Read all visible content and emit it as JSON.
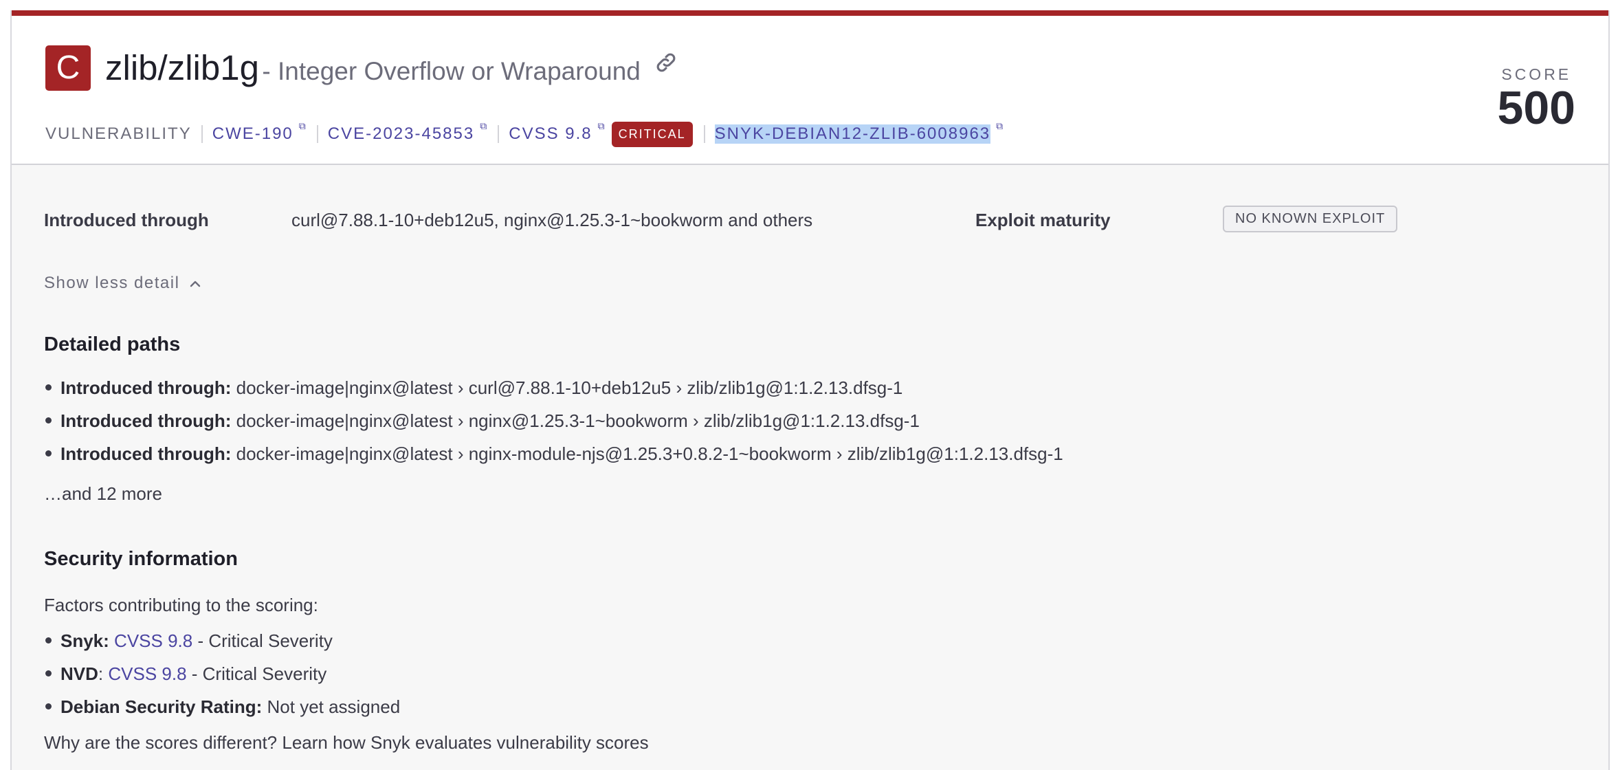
{
  "header": {
    "severity_letter": "C",
    "package": "zlib/zlib1g",
    "issue_title": "- Integer Overflow or Wraparound",
    "type_label": "VULNERABILITY",
    "cwe": "CWE-190",
    "cve": "CVE-2023-45853",
    "cvss": "CVSS 9.8",
    "severity_badge": "CRITICAL",
    "snyk_id": "SNYK-DEBIAN12-ZLIB-6008963",
    "score_label": "SCORE",
    "score_value": "500",
    "accent_color": "#a42426",
    "link_color": "#4b45a1"
  },
  "overview": {
    "introduced_label": "Introduced through",
    "introduced_value": "curl@7.88.1-10+deb12u5, nginx@1.25.3-1~bookworm and others",
    "exploit_label": "Exploit maturity",
    "exploit_value": "NO KNOWN EXPLOIT",
    "toggle_label": "Show less detail"
  },
  "paths": {
    "heading": "Detailed paths",
    "item_label": "Introduced through:",
    "items": [
      "docker-image|nginx@latest › curl@7.88.1-10+deb12u5 › zlib/zlib1g@1:1.2.13.dfsg-1",
      "docker-image|nginx@latest › nginx@1.25.3-1~bookworm › zlib/zlib1g@1:1.2.13.dfsg-1",
      "docker-image|nginx@latest › nginx-module-njs@1.25.3+0.8.2-1~bookworm › zlib/zlib1g@1:1.2.13.dfsg-1"
    ],
    "more_link": "…and 12 more"
  },
  "security": {
    "heading": "Security information",
    "intro": "Factors contributing to the scoring:",
    "factors": [
      {
        "source": "Snyk:",
        "link": "CVSS 9.8",
        "text": " - Critical Severity"
      },
      {
        "source": "NVD",
        "sep": ": ",
        "link": "CVSS 9.8",
        "text": " - Critical Severity"
      },
      {
        "source": "Debian Security Rating:",
        "text": " Not yet assigned"
      }
    ],
    "learn_link": "Why are the scores different? Learn how Snyk evaluates vulnerability scores"
  },
  "icons": [
    "link-icon",
    "external-link-icon",
    "chevron-up-icon",
    "bullet-icon"
  ]
}
